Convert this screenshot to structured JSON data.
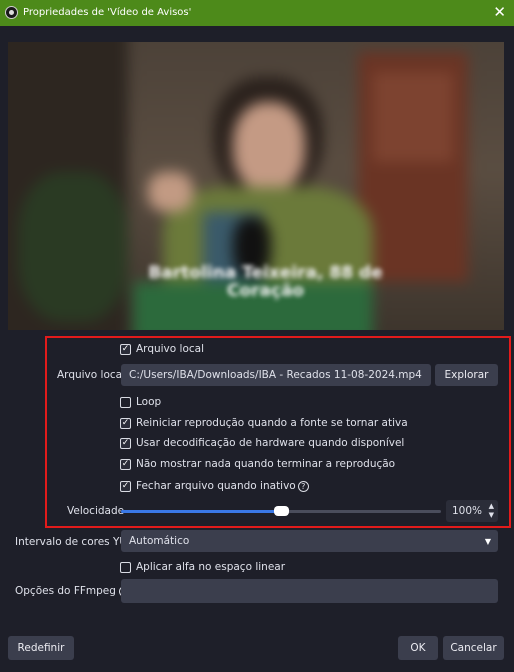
{
  "window": {
    "title": "Propriedades de 'Vídeo de Avisos'"
  },
  "local_file_checkbox": {
    "label": "Arquivo local",
    "checked": true
  },
  "local_file": {
    "label": "Arquivo local",
    "path": "C:/Users/IBA/Downloads/IBA - Recados 11-08-2024.mp4",
    "browse_label": "Explorar"
  },
  "options": [
    {
      "label": "Loop",
      "checked": false
    },
    {
      "label": "Reiniciar reprodução quando a fonte se tornar ativa",
      "checked": true
    },
    {
      "label": "Usar decodificação de hardware quando disponível",
      "checked": true
    },
    {
      "label": "Não mostrar nada quando terminar a reprodução",
      "checked": true
    },
    {
      "label": "Fechar arquivo quando inativo",
      "checked": true
    }
  ],
  "speed": {
    "label": "Velocidade",
    "value_text": "100%",
    "fraction": 0.5
  },
  "yuv": {
    "label": "Intervalo de cores YUV",
    "value": "Automático"
  },
  "alpha_linear": {
    "label": "Aplicar alfa no espaço linear",
    "checked": false
  },
  "ffmpeg": {
    "label": "Opções do FFmpeg",
    "value": ""
  },
  "footer": {
    "reset_label": "Redefinir",
    "ok_label": "OK",
    "cancel_label": "Cancelar"
  },
  "video_overlay_text": "Bartolina Teixeira, 88 de Coração",
  "colors": {
    "titlebar": "#4d8a1a",
    "background": "#1e1f29",
    "highlight": "#e21b1b",
    "slider": "#3a78e6"
  }
}
